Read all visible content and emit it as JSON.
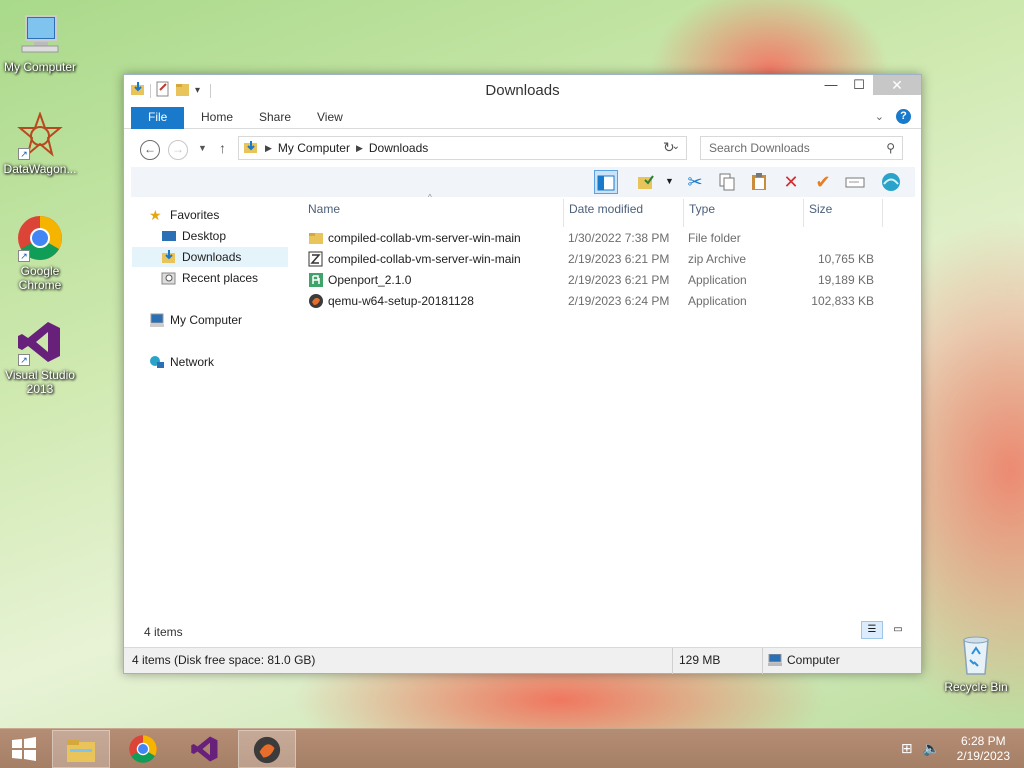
{
  "desktop": {
    "icons": [
      {
        "label": "My Computer",
        "icon": "computer-icon"
      },
      {
        "label": "DataWagon...",
        "icon": "datawagon-icon"
      },
      {
        "label": "Google Chrome",
        "icon": "chrome-icon"
      },
      {
        "label": "Visual Studio 2013",
        "icon": "visual-studio-icon"
      },
      {
        "label": "Recycle Bin",
        "icon": "recycle-bin-icon"
      }
    ]
  },
  "window": {
    "title": "Downloads",
    "close_glyph": "✕",
    "minimize_glyph": "—",
    "maximize_glyph": "☐"
  },
  "ribbon": {
    "tabs": [
      "File",
      "Home",
      "Share",
      "View"
    ],
    "help": "?"
  },
  "address": {
    "crumbs": [
      "My Computer",
      "Downloads"
    ],
    "search_placeholder": "Search Downloads"
  },
  "navpane": {
    "favorites": "Favorites",
    "desktop": "Desktop",
    "downloads": "Downloads",
    "recent": "Recent places",
    "my_computer": "My Computer",
    "network": "Network"
  },
  "columns": {
    "name": "Name",
    "date": "Date modified",
    "type": "Type",
    "size": "Size"
  },
  "files": [
    {
      "name": "compiled-collab-vm-server-win-main",
      "date": "1/30/2022 7:38 PM",
      "type": "File folder",
      "size": "",
      "icon": "folder-icon"
    },
    {
      "name": "compiled-collab-vm-server-win-main",
      "date": "2/19/2023 6:21 PM",
      "type": "zip Archive",
      "size": "10,765 KB",
      "icon": "zip-archive-icon"
    },
    {
      "name": "Openport_2.1.0",
      "date": "2/19/2023 6:21 PM",
      "type": "Application",
      "size": "19,189 KB",
      "icon": "openport-icon"
    },
    {
      "name": "qemu-w64-setup-20181128",
      "date": "2/19/2023 6:24 PM",
      "type": "Application",
      "size": "102,833 KB",
      "icon": "qemu-icon"
    }
  ],
  "status": {
    "count": "4 items",
    "disk": "4 items (Disk free space: 81.0 GB)",
    "size": "129 MB",
    "location": "Computer"
  },
  "taskbar": {
    "time": "6:28 PM",
    "date": "2/19/2023"
  },
  "colors": {
    "accent": "#1979ca",
    "selection": "#e5f3fb",
    "taskbar": "#a57f66"
  }
}
